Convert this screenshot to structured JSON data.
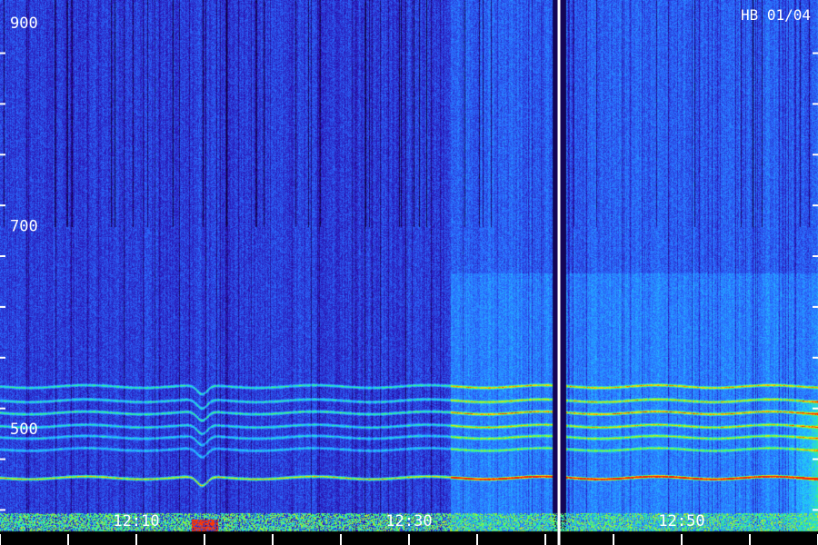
{
  "chart_data": {
    "type": "heatmap",
    "title": "HB 01/04",
    "y_unit": "",
    "y_ticks": [
      {
        "value": 900,
        "label": "900"
      },
      {
        "value": 700,
        "label": "700"
      },
      {
        "value": 500,
        "label": "500"
      }
    ],
    "ylim": [
      410,
      930
    ],
    "x_ticks": [
      {
        "value": "12:10",
        "label": "12:10"
      },
      {
        "value": "12:30",
        "label": "12:30"
      },
      {
        "value": "12:50",
        "label": "12:50"
      }
    ],
    "xlim": [
      "12:00",
      "13:00"
    ],
    "data_gap_time": "12:41",
    "colormap": [
      "#0a0030",
      "#2a10b0",
      "#2b6cff",
      "#22c8ff",
      "#3cff6a",
      "#ffe000",
      "#ff2000"
    ],
    "bands": [
      {
        "freq": 542,
        "intensity": 0.55
      },
      {
        "freq": 528,
        "intensity": 0.5
      },
      {
        "freq": 516,
        "intensity": 0.6
      },
      {
        "freq": 503,
        "intensity": 0.5
      },
      {
        "freq": 492,
        "intensity": 0.45
      },
      {
        "freq": 480,
        "intensity": 0.4
      },
      {
        "freq": 452,
        "intensity": 0.9
      }
    ]
  },
  "colors": {
    "background": "#000000",
    "axis": "#ffffff",
    "low": "#1a0a80",
    "band": "#44ff66"
  }
}
